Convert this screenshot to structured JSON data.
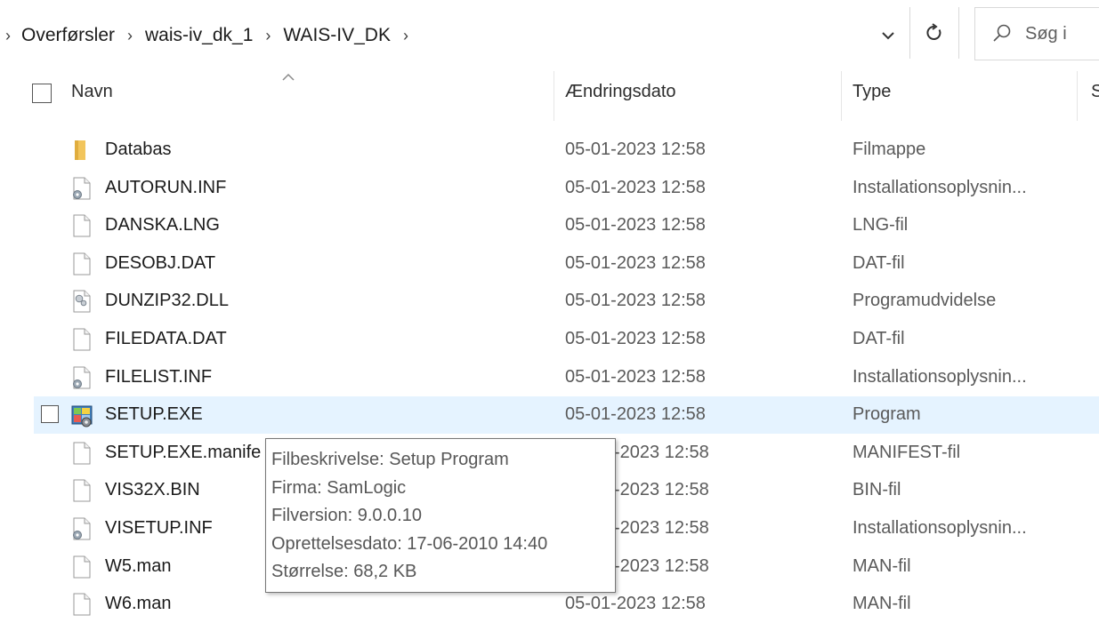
{
  "address_bar": {
    "breadcrumbs": [
      "Overførsler",
      "wais-iv_dk_1",
      "WAIS-IV_DK"
    ],
    "search_placeholder": "Søg i"
  },
  "columns": {
    "name": "Navn",
    "date": "Ændringsdato",
    "type": "Type"
  },
  "files": [
    {
      "name": "Databas",
      "date": "05-01-2023 12:58",
      "type": "Filmappe",
      "icon": "folder-icon"
    },
    {
      "name": "AUTORUN.INF",
      "date": "05-01-2023 12:58",
      "type": "Installationsoplysnin...",
      "icon": "setup-info-file-icon"
    },
    {
      "name": "DANSKA.LNG",
      "date": "05-01-2023 12:58",
      "type": "LNG-fil",
      "icon": "file-icon"
    },
    {
      "name": "DESOBJ.DAT",
      "date": "05-01-2023 12:58",
      "type": "DAT-fil",
      "icon": "file-icon"
    },
    {
      "name": "DUNZIP32.DLL",
      "date": "05-01-2023 12:58",
      "type": "Programudvidelse",
      "icon": "dll-file-icon"
    },
    {
      "name": "FILEDATA.DAT",
      "date": "05-01-2023 12:58",
      "type": "DAT-fil",
      "icon": "file-icon"
    },
    {
      "name": "FILELIST.INF",
      "date": "05-01-2023 12:58",
      "type": "Installationsoplysnin...",
      "icon": "setup-info-file-icon"
    },
    {
      "name": "SETUP.EXE",
      "date": "05-01-2023 12:58",
      "type": "Program",
      "icon": "setup-program-icon",
      "selected": true
    },
    {
      "name": "SETUP.EXE.manife",
      "date": "-2023 12:58",
      "type": "MANIFEST-fil",
      "icon": "file-icon"
    },
    {
      "name": "VIS32X.BIN",
      "date": "-2023 12:58",
      "type": "BIN-fil",
      "icon": "file-icon"
    },
    {
      "name": "VISETUP.INF",
      "date": "-2023 12:58",
      "type": "Installationsoplysnin...",
      "icon": "setup-info-file-icon"
    },
    {
      "name": "W5.man",
      "date": "-2023 12:58",
      "type": "MAN-fil",
      "icon": "file-icon"
    },
    {
      "name": "W6.man",
      "date": "05-01-2023 12:58",
      "type": "MAN-fil",
      "icon": "file-icon"
    }
  ],
  "tooltip": {
    "description": "Filbeskrivelse: Setup Program",
    "company": "Firma: SamLogic",
    "version": "Filversion: 9.0.0.10",
    "created": "Oprettelsesdato: 17-06-2010 14:40",
    "size": "Størrelse: 68,2 KB"
  },
  "colors": {
    "selection": "#e5f3ff",
    "folder": "#f2c55c"
  }
}
